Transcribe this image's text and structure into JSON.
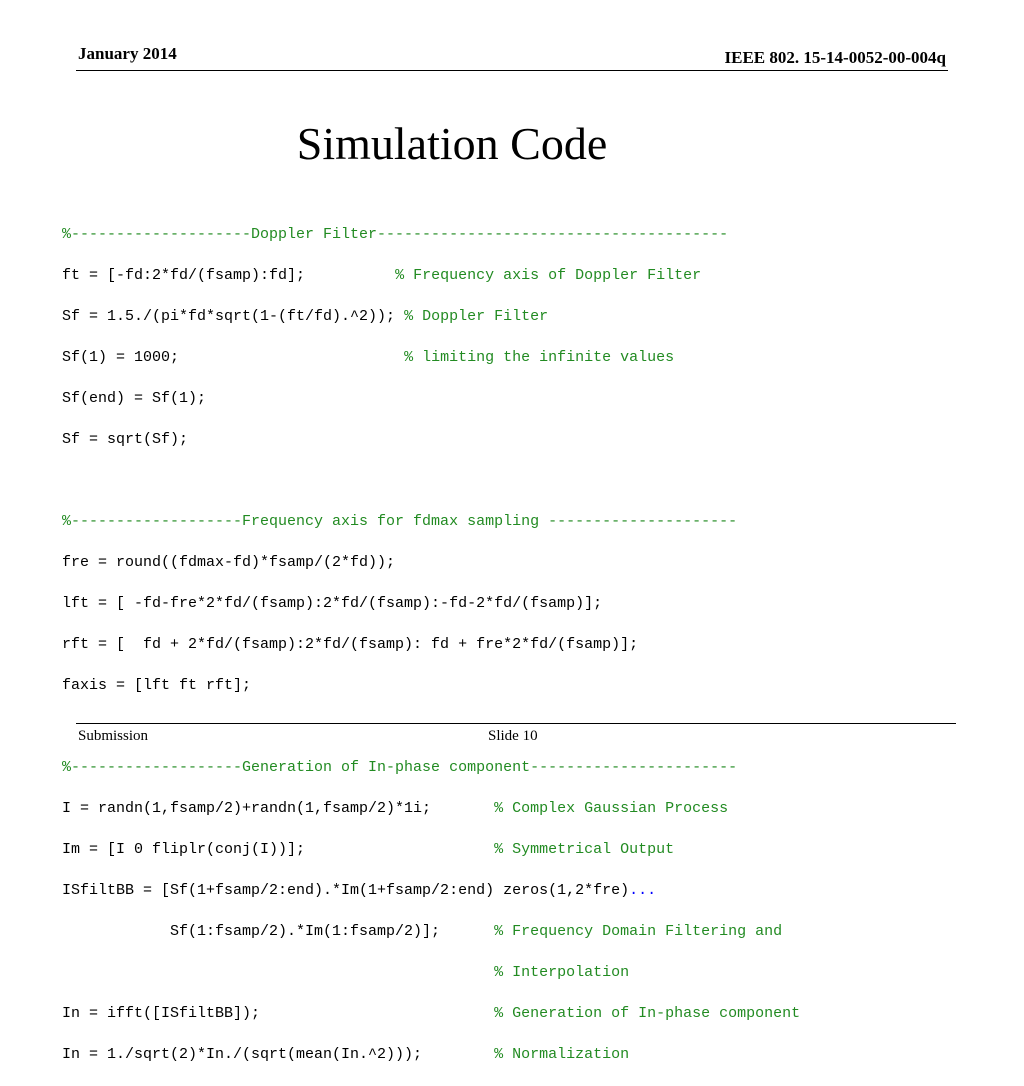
{
  "header": {
    "date": "January 2014",
    "doc_id": "IEEE 802. 15-14-0052-00-004q"
  },
  "title": "Simulation Code",
  "code": {
    "l1": "%--------------------Doppler Filter---------------------------------------",
    "l2_code": "ft = [-fd:2*fd/(fsamp):fd];",
    "l2_pad": "          ",
    "l2_comment": "% Frequency axis of Doppler Filter",
    "l3_code": "Sf = 1.5./(pi*fd*sqrt(1-(ft/fd).^2));",
    "l3_pad": " ",
    "l3_comment": "% Doppler Filter",
    "l4_code": "Sf(1) = 1000;",
    "l4_pad": "                         ",
    "l4_comment": "% limiting the infinite values",
    "l5": "Sf(end) = Sf(1);",
    "l6": "Sf = sqrt(Sf);",
    "l7": "",
    "l8": "%-------------------Frequency axis for fdmax sampling ---------------------",
    "l9": "fre = round((fdmax-fd)*fsamp/(2*fd));",
    "l10": "lft = [ -fd-fre*2*fd/(fsamp):2*fd/(fsamp):-fd-2*fd/(fsamp)];",
    "l11": "rft = [  fd + 2*fd/(fsamp):2*fd/(fsamp): fd + fre*2*fd/(fsamp)];",
    "l12": "faxis = [lft ft rft];",
    "l13": "",
    "l14": "%-------------------Generation of In-phase component-----------------------",
    "l15_code": "I = randn(1,fsamp/2)+randn(1,fsamp/2)*1i;",
    "l15_pad": "       ",
    "l15_comment": "% Complex Gaussian Process",
    "l16_code": "Im = [I 0 fliplr(conj(I))];",
    "l16_pad": "                     ",
    "l16_comment": "% Symmetrical Output",
    "l17_code": "ISfiltBB = [Sf(1+fsamp/2:end).*Im(1+fsamp/2:end) zeros(1,2*fre)",
    "l17_ellipsis": "...",
    "l18_code": "            Sf(1:fsamp/2).*Im(1:fsamp/2)];",
    "l18_pad": "      ",
    "l18_comment": "% Frequency Domain Filtering and",
    "l19_pad": "                                                ",
    "l19_comment": "% Interpolation",
    "l20_code": "In = ifft([ISfiltBB]);",
    "l20_pad": "                          ",
    "l20_comment": "% Generation of In-phase component",
    "l21_code": "In = 1./sqrt(2)*In./(sqrt(mean(In.^2)));",
    "l21_pad": "        ",
    "l21_comment": "% Normalization"
  },
  "footer": {
    "left": "Submission",
    "slide": "Slide 10"
  },
  "colors": {
    "comment": "#228b22",
    "ellipsis": "#0000ff",
    "text": "#000000"
  }
}
